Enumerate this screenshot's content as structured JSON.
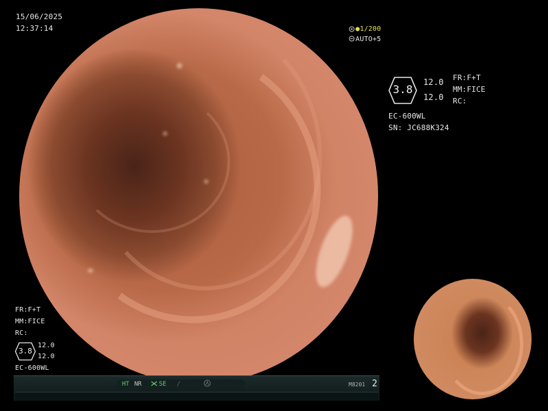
{
  "timestamp": {
    "date": "15/06/2025",
    "time": "12:37:14"
  },
  "exposure": {
    "shutter": "●1/200",
    "auto": "AUTO+5"
  },
  "right_panel": {
    "badge_value": "3.8",
    "enhance_a": "12.0",
    "enhance_b": "12.0",
    "fr": "FR:F+T",
    "mm": "MM:FICE",
    "rc": "RC:",
    "scope_model": "EC-600WL",
    "serial": "SN: JC688K324"
  },
  "left_panel": {
    "fr": "FR:F+T",
    "mm": "MM:FICE",
    "rc": "RC:",
    "badge_value": "3.8",
    "enhance_a": "12.0",
    "enhance_b": "12.0",
    "scope_model": "EC-600WL"
  },
  "status_bar": {
    "ht": "HT",
    "nr": "NR",
    "se": "SE",
    "slash": "∕",
    "device_code": "M8201",
    "page_number": "2"
  },
  "icons": {
    "shutter_icon": "shutter-icon",
    "auto_icon": "auto-exposure-icon",
    "scissors_icon": "se-icon",
    "circle_a_icon": "circle-a-icon"
  }
}
